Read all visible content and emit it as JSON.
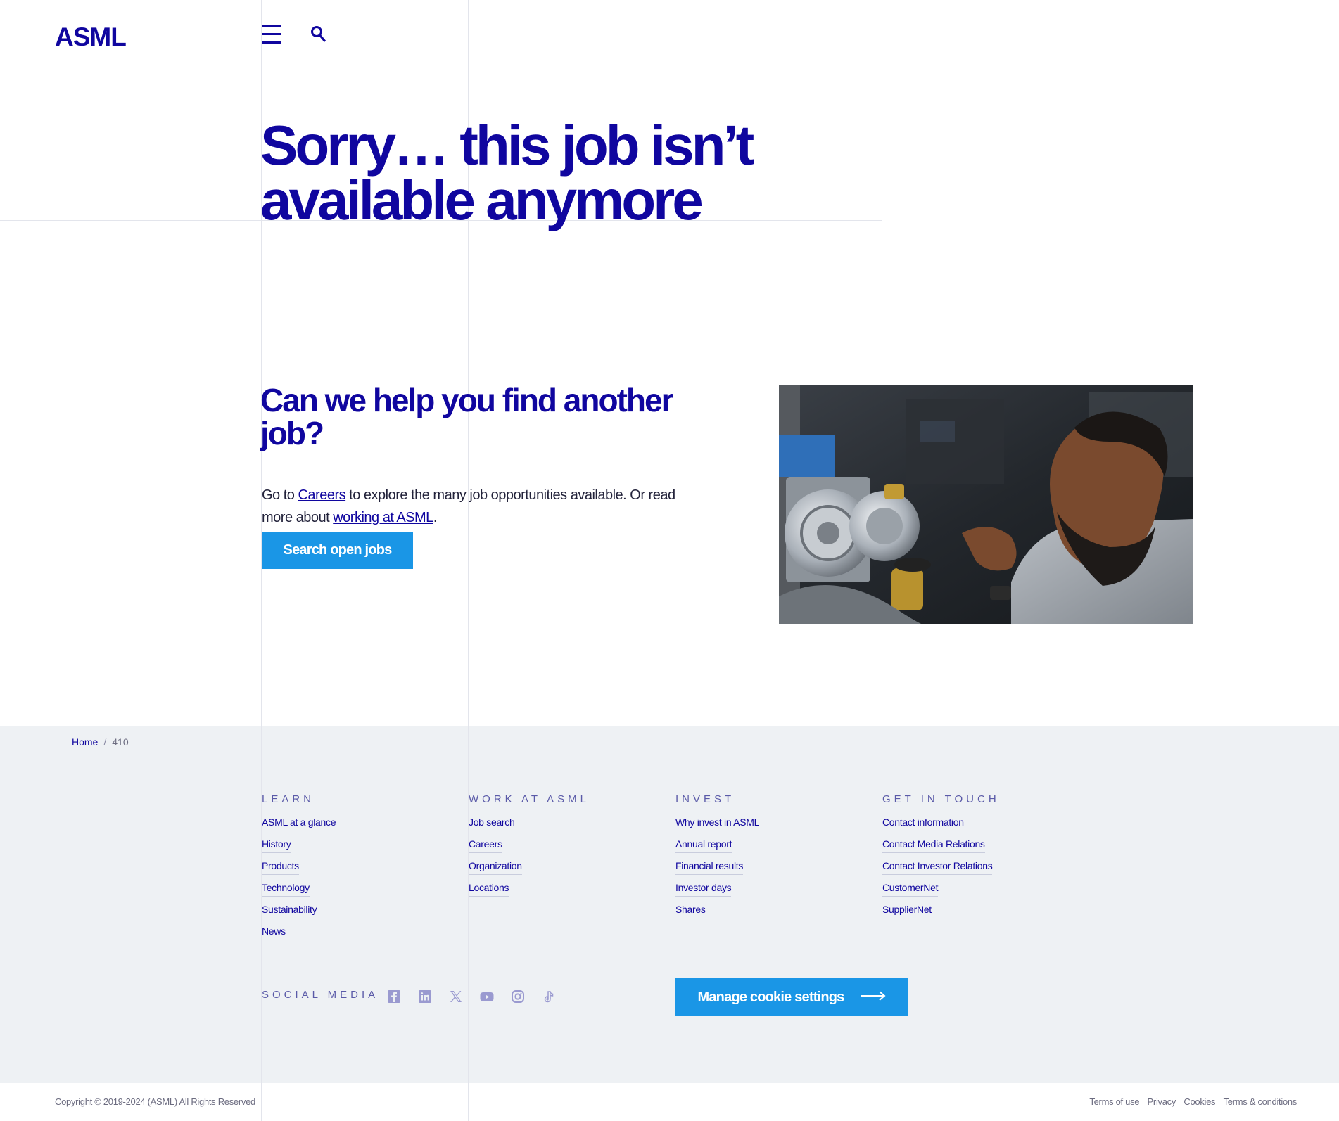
{
  "header": {
    "logo": "ASML",
    "menu_icon": "hamburger-menu-icon",
    "search_icon": "search-icon"
  },
  "hero": {
    "title": "Sorry… this job isn’t available anymore"
  },
  "help": {
    "title": "Can we help you find another job?",
    "text_1": "Go to ",
    "careers_link": "Careers",
    "text_2": " to explore the many job opportunities available. Or read more about ",
    "working_link": "working at ASML",
    "text_3": ".",
    "button": "Search open jobs"
  },
  "breadcrumb": {
    "home": "Home",
    "separator": "/",
    "current": "410"
  },
  "footer": {
    "columns": [
      {
        "heading": "LEARN",
        "links": [
          "ASML at a glance",
          "History",
          "Products",
          "Technology",
          "Sustainability",
          "News"
        ]
      },
      {
        "heading": "WORK AT ASML",
        "links": [
          "Job search",
          "Careers",
          "Organization",
          "Locations"
        ]
      },
      {
        "heading": "INVEST",
        "links": [
          "Why invest in ASML",
          "Annual report",
          "Financial results",
          "Investor days",
          "Shares"
        ]
      },
      {
        "heading": "GET IN TOUCH",
        "links": [
          "Contact information",
          "Contact Media Relations",
          "Contact Investor Relations",
          "CustomerNet",
          "SupplierNet"
        ]
      }
    ],
    "social_label": "SOCIAL MEDIA",
    "social_icons": [
      "facebook-icon",
      "linkedin-icon",
      "x-icon",
      "youtube-icon",
      "instagram-icon",
      "tiktok-icon"
    ],
    "cookie_button": "Manage cookie settings"
  },
  "bottom": {
    "copyright": "Copyright © 2019-2024 (ASML) All Rights Reserved",
    "legal_links": [
      "Terms of use",
      "Privacy",
      "Cookies",
      "Terms & conditions"
    ]
  },
  "colors": {
    "brand": "#10069f",
    "accent_button": "#1a96e6",
    "footer_bg": "#eef1f4"
  }
}
